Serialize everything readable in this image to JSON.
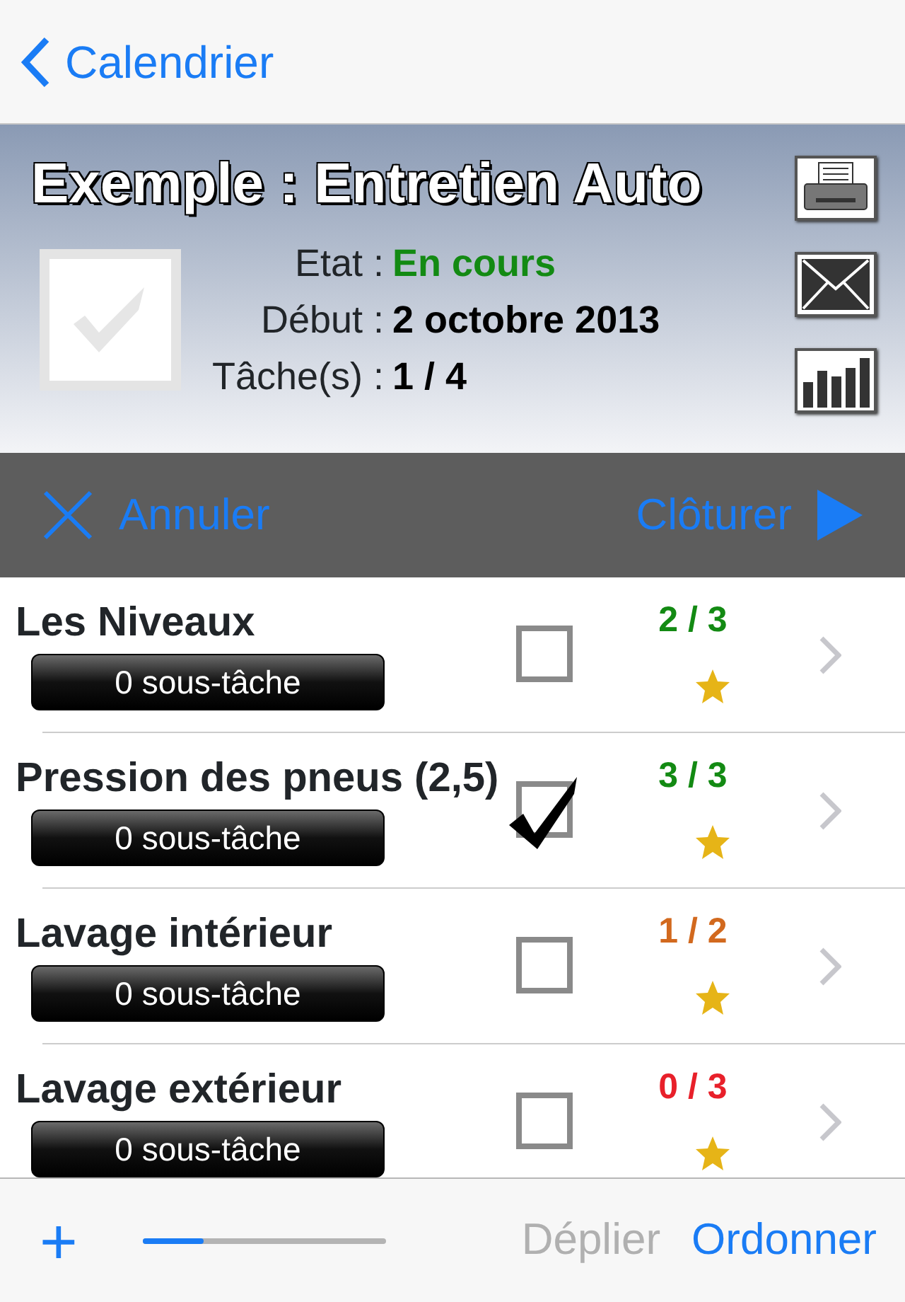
{
  "nav": {
    "back_label": "Calendrier"
  },
  "header": {
    "title": "Exemple : Entretien Auto",
    "checked": false,
    "fields": [
      {
        "label": "Etat :",
        "value": "En cours",
        "color": "#138a13"
      },
      {
        "label": "Début :",
        "value": "2 octobre 2013",
        "color": "#000000"
      },
      {
        "label": "Tâche(s) :",
        "value": "1 / 4",
        "color": "#000000"
      }
    ]
  },
  "action_bar": {
    "cancel": "Annuler",
    "close": "Clôturer"
  },
  "tasks": [
    {
      "name": "Les Niveaux",
      "subtasks": "0 sous-tâche",
      "checked": false,
      "score": "2 / 3",
      "color": "#138a13",
      "starred": true
    },
    {
      "name": "Pression des pneus (2,5)",
      "subtasks": "0 sous-tâche",
      "checked": true,
      "score": "3 / 3",
      "color": "#138a13",
      "starred": true
    },
    {
      "name": "Lavage intérieur",
      "subtasks": "0 sous-tâche",
      "checked": false,
      "score": "1 / 2",
      "color": "#d2691e",
      "starred": true
    },
    {
      "name": "Lavage extérieur",
      "subtasks": "0 sous-tâche",
      "checked": false,
      "score": "0 / 3",
      "color": "#e8202a",
      "starred": true
    }
  ],
  "toolbar": {
    "add": "+",
    "level": 0.25,
    "expand": {
      "label": "Déplier",
      "disabled": true
    },
    "order": {
      "label": "Ordonner",
      "disabled": false
    }
  }
}
